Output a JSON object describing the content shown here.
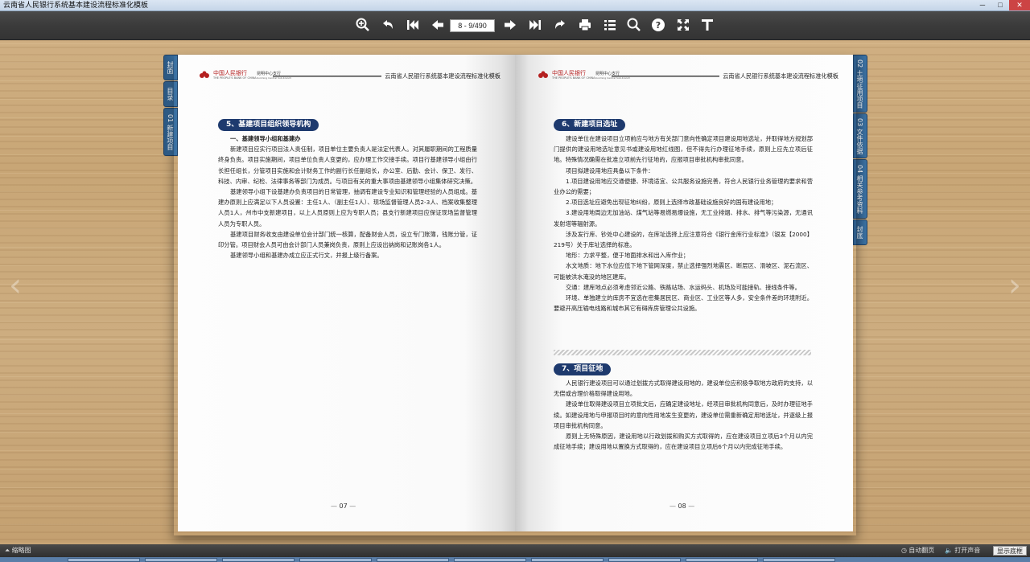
{
  "window": {
    "title": "云南省人民银行系统基本建设流程标准化模板",
    "buttons": [
      "─",
      "□",
      "✕"
    ]
  },
  "toolbar": {
    "page_indicator": "8 - 9/490",
    "icons": [
      "zoom-in-icon",
      "undo-icon",
      "first-page-icon",
      "prev-page-icon",
      "next-page-icon",
      "last-page-icon",
      "redo-icon",
      "print-icon",
      "list-icon",
      "search-icon",
      "help-icon",
      "fullscreen-icon",
      "text-icon"
    ]
  },
  "header": {
    "bank_cn": "中国人民银行",
    "bank_en": "THE PEOPLE'S BANK OF CHINA",
    "branch_cn": "昆明中心支行",
    "branch_en": "Kunming Central Sub-branch",
    "doc_title": "云南省人民银行系统基本建设流程标准化模板"
  },
  "left_tabs": [
    {
      "label": "封面"
    },
    {
      "label": "目录"
    },
    {
      "label": "01 新建项目"
    }
  ],
  "right_tabs": [
    {
      "label": "02 土地征用项目"
    },
    {
      "label": "03 文件依据"
    },
    {
      "label": "04 相关参考资料"
    },
    {
      "label": "封底"
    }
  ],
  "left_page": {
    "section_title": "5、基建项目组织领导机构",
    "subheading": "一、基建领导小组和基建办",
    "paragraphs": [
      "新建项目应实行项目法人责任制，项目单位主要负责人是法定代表人。对其履职期间的工程质量终身负责。项目实施期间，项目单位负责人变更的，应办理工作交接手续。项目行基建领导小组由行长担任组长，分管项目实施和会计财务工作的副行长任副组长，办公室、后勤、会计、保卫、发行、科技、内审、纪检、法律事务等部门为成员。与项目有关的重大事项由基建领导小组集体研究决策。",
      "基建领导小组下设基建办负责项目的日常管理，抽调有建设专业知识和管理经验的人员组成。基建办原则上应满足以下人员设置：主任1人、（副主任1人）、现场监督管理人员2-3人、档案收集整理人员1人，州市中支新建项目，以上人员原则上应为专职人员；县支行新建项目应保证现场监督管理人员为专职人员。",
      "基建项目财务收支由建设单位会计部门统一核算，配备财会人员，设立专门账簿，钱账分管，证印分管。项目财会人员可由会计部门人员兼岗负责，原则上应设出纳岗和记账岗各1人。",
      "基建领导小组和基建办成立应正式行文，并报上级行备案。"
    ],
    "page_number": "07"
  },
  "right_page": {
    "section6_title": "6、新建项目选址",
    "section6_paragraphs": [
      "建设单位在建设项目立项前应与地方有关部门意向性确定项目建设用地选址，并取得地方规划部门提供的建设用地选址意见书或建设用地红线图，但不得先行办理征地手续，原则上应先立项后征地。特殊情况确需在批准立项前先行征地的，应报项目审批机构审批同意。",
      "项目拟建设用地应具备以下条件：",
      "1.项目建设用地应交通便捷、环境适宜、公共服务设施完善，符合人民银行业务管理的要求和营业办公的需要；",
      "2.项目选址应避免出现征地纠纷，原则上选择市政基础设施良好的国有建设用地；",
      "3.建设用地周边无加油站、煤气站等易燃易爆设施，无工业排烟、排水、排气等污染源，无通讯发射塔等辐射源。",
      "涉及发行库、钞处中心建设的，在库址选择上应注意符合《银行金库行业标准》（银发【2000】219号）关于库址选择的标准。",
      "地形：力求平整，便于地面排水和出入库作业；",
      "水文地质：地下水位应低下地下管网深度，禁止选择强烈地震区、断层区、滑坡区、泥石流区、可能被洪水淹没的地区建库。",
      "交通：建库地点必须考虑邻近公路、铁路站场、水运码头、机场及可能接轨、接线条件等。",
      "环境、单独建立的库房不宜选在密集居民区、商业区、工业区等人多，安全条件差的环境附近。要避开高压输电线路和城市其它有碍库房管理公共设施。"
    ],
    "section7_title": "7、项目征地",
    "section7_paragraphs": [
      "人民银行建设项目可以通过划拨方式取得建设用地的，建设单位应积极争取地方政府的支持，以无偿或合理价格取得建设用地。",
      "建设单位取得建设项目立项批文后，应确定建设地址，经项目审批机构同意后，及时办理征地手续。如建设用地与申报项目时的意向性用地发生变更的，建设单位需重新确定用地选址，并逐级上报项目审批机构同意。",
      "原则上无特殊原因，建设用地以行政划拨和购买方式取得的，应在建设项目立项后3个月以内完成征地手续；建设用地以置换方式取得的，应在建设项目立项后6个月以内完成征地手续。"
    ],
    "page_number": "08"
  },
  "bottom_bar": {
    "thumbnail_label": "缩略图",
    "auto_flip": "自动翻页",
    "sound": "打开声音",
    "show_toolbar": "显示底框"
  },
  "colors": {
    "accent": "#1e3a6e",
    "toolbar": "#3b3b3b",
    "tab": "#2d5a86",
    "logo_red": "#b42020"
  }
}
